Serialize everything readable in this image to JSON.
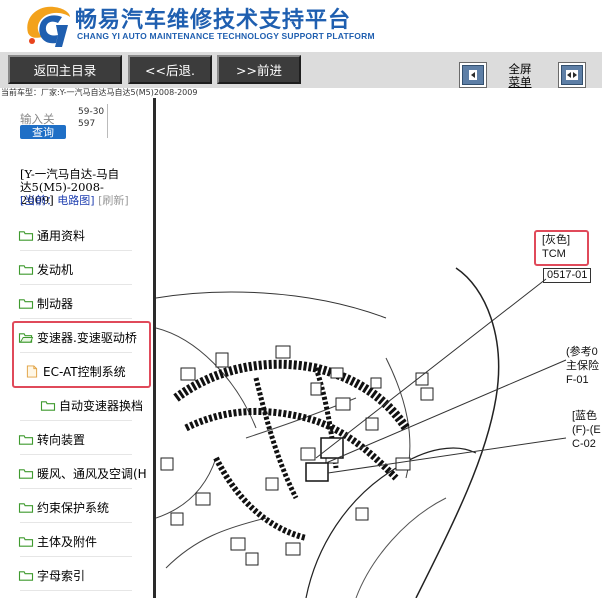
{
  "header": {
    "title_cn": "畅易汽车维修技术支持平台",
    "title_en": "CHANG YI AUTO MAINTENANCE TECHNOLOGY SUPPORT PLATFORM",
    "logo_icon": "cy-logo-icon",
    "brand_color": "#1f5fb0"
  },
  "toolbar": {
    "home_label": "返回主目录",
    "back_label": "<<后退.",
    "forward_label": ">>前进",
    "fullscreen_label_line1": "全屏",
    "fullscreen_label_line2": "菜单",
    "collapse_icon": "collapse-left-icon",
    "expand_icon": "expand-both-icon"
  },
  "vehicle_line": "当前车型：厂家:Y-一汽马自达马自达5(M5)2008-2009",
  "sidebar": {
    "search_placeholder": "输入关",
    "search_value": "59-30597",
    "search_button": "查询",
    "vehicle_title": "[Y-一汽马自达-马自达5(M5)-2008-2009]",
    "current_prefix": "[当前：电路图]",
    "refresh_label": "[刷新]",
    "items": [
      {
        "label": "通用资料",
        "icon": "folder-icon",
        "level": 0
      },
      {
        "label": "发动机",
        "icon": "folder-icon",
        "level": 0
      },
      {
        "label": "制动器",
        "icon": "folder-icon",
        "level": 0
      },
      {
        "label": "变速器.变速驱动桥",
        "icon": "folder-open-icon",
        "level": 0
      },
      {
        "label": "EC-AT控制系统",
        "icon": "document-icon",
        "level": 1
      },
      {
        "label": "自动变速器换档",
        "icon": "folder-icon",
        "level": 2
      },
      {
        "label": "转向装置",
        "icon": "folder-icon",
        "level": 0
      },
      {
        "label": "暖风、通风及空调(H",
        "icon": "folder-icon",
        "level": 0
      },
      {
        "label": "约束保护系统",
        "icon": "folder-icon",
        "level": 0
      },
      {
        "label": "主体及附件",
        "icon": "folder-icon",
        "level": 0
      },
      {
        "label": "字母索引",
        "icon": "folder-icon",
        "level": 0
      }
    ]
  },
  "diagram": {
    "callout_tcm_line1": "[灰色]",
    "callout_tcm_line2": "TCM",
    "code_0517": "0517-01",
    "callout_ref_line1": "(参考0",
    "callout_ref_line2": "主保险",
    "callout_ref_line3": "F-01",
    "callout_blue_line1": "[蓝色",
    "callout_blue_line2": "(F)-(E",
    "callout_blue_line3": "C-02",
    "accent_red": "#e04a5a"
  }
}
